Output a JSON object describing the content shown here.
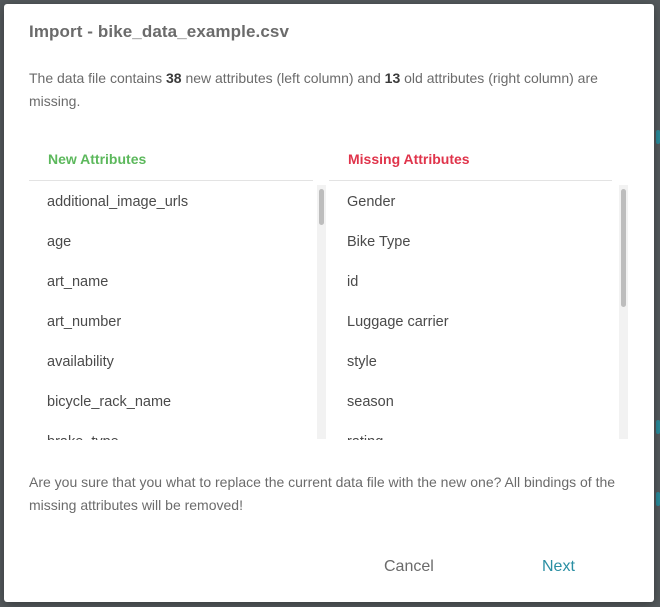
{
  "dialog": {
    "title": "Import - bike_data_example.csv",
    "summary": {
      "prefix": "The data file contains ",
      "new_count": "38",
      "middle": " new attributes (left column) and ",
      "old_count": "13",
      "suffix": " old attributes (right column) are missing."
    },
    "new_attributes": {
      "header": "New Attributes",
      "items": [
        "additional_image_urls",
        "age",
        "art_name",
        "art_number",
        "availability",
        "bicycle_rack_name",
        "brake_type"
      ]
    },
    "missing_attributes": {
      "header": "Missing Attributes",
      "items": [
        "Gender",
        "Bike Type",
        "id",
        "Luggage carrier",
        "style",
        "season",
        "rating"
      ]
    },
    "warning": "Are you sure that you what to replace the current data file with the new one? All bindings of the missing attributes will be removed!",
    "buttons": {
      "cancel": "Cancel",
      "next": "Next"
    }
  },
  "colors": {
    "new_header": "#5cb85c",
    "missing_header": "#e0344b",
    "accent": "#2a8fa3"
  }
}
